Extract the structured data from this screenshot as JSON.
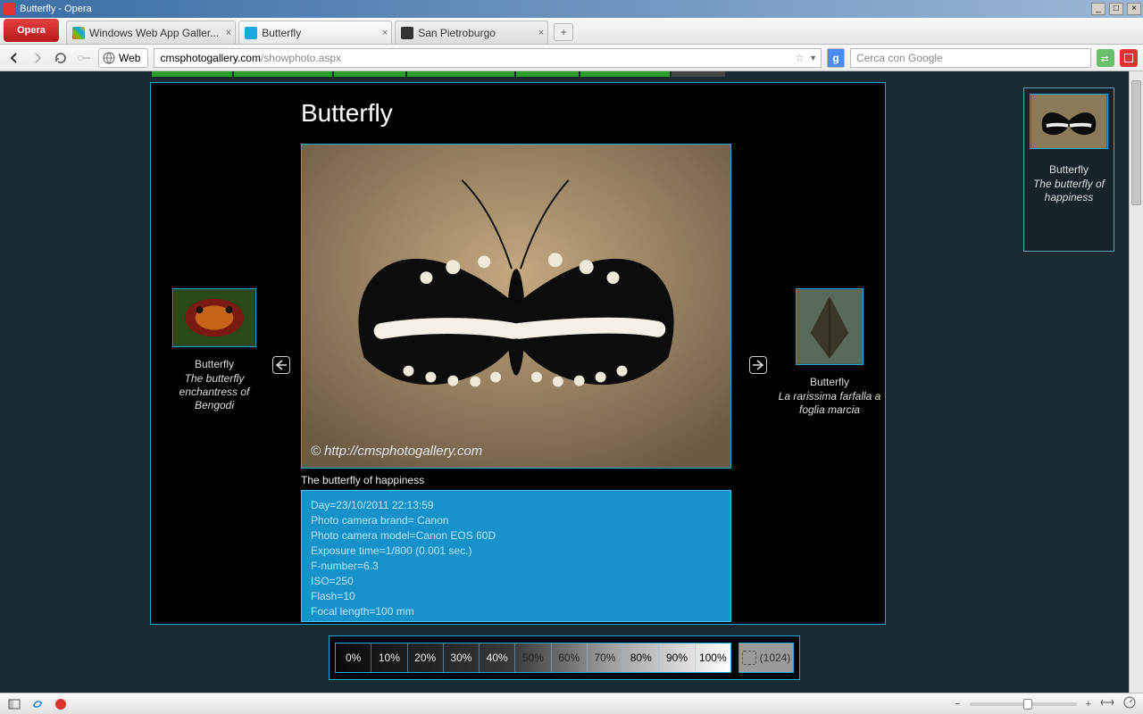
{
  "window": {
    "title": "Butterfly - Opera"
  },
  "opera_button": "Opera",
  "tabs": [
    {
      "label": "Windows Web App Galler...",
      "active": false
    },
    {
      "label": "Butterfly",
      "active": true
    },
    {
      "label": "San Pietroburgo",
      "active": false
    }
  ],
  "nav": {
    "web_label": "Web",
    "url_host": "cmsphotogallery.com",
    "url_path": "/showphoto.aspx",
    "search_placeholder": "Cerca con Google"
  },
  "page": {
    "title": "Butterfly",
    "caption": "The butterfly of happiness",
    "exif": {
      "day": "Day=23/10/2011 22:13:59",
      "brand": "Photo camera brand= Canon",
      "model": "Photo camera model=Canon EOS 60D",
      "exposure": "Exposure time=1/800 (0.001 sec.)",
      "fnumber": "F-number=6.3",
      "iso": "ISO=250",
      "flash": "Flash=10",
      "focal": "Focal length=100 mm"
    },
    "watermark": "© http://cmsphotogallery.com",
    "prev_thumb": {
      "title": "Butterfly",
      "subtitle": "The butterfly enchantress of Bengodi"
    },
    "next_thumb": {
      "title": "Butterfly",
      "subtitle": "La rarissima farfalla a foglia marcia"
    }
  },
  "right_panel": {
    "title": "Butterfly",
    "subtitle": "The butterfly of happiness"
  },
  "zoom": {
    "levels": [
      "0%",
      "10%",
      "20%",
      "30%",
      "40%",
      "50%",
      "60%",
      "70%",
      "80%",
      "90%",
      "100%"
    ],
    "aux": "(1024)"
  }
}
